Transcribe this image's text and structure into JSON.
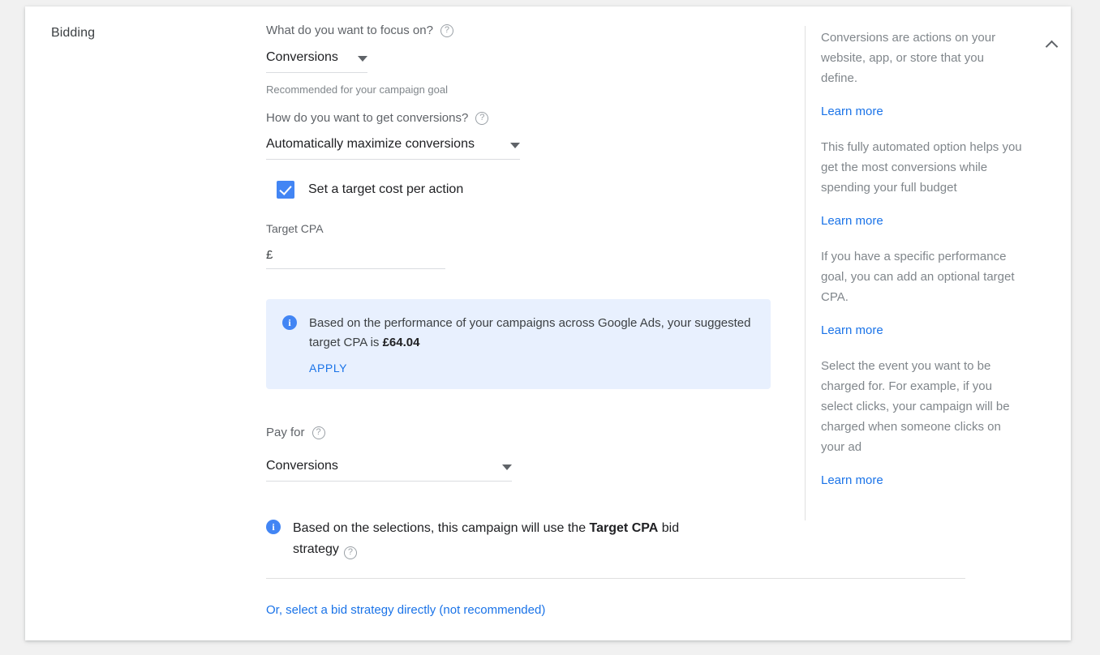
{
  "section": {
    "title": "Bidding"
  },
  "focus": {
    "label": "What do you want to focus on?",
    "help_icon": "help-circle-icon",
    "value": "Conversions",
    "helper_text": "Recommended for your campaign goal"
  },
  "strategy": {
    "label": "How do you want to get conversions?",
    "help_icon": "help-circle-icon",
    "value": "Automatically maximize conversions"
  },
  "target_cpa_checkbox": {
    "label": "Set a target cost per action",
    "checked": true,
    "accent_color": "#4285f4"
  },
  "target_cpa_input": {
    "label": "Target CPA",
    "currency_prefix": "£",
    "value": "",
    "placeholder": ""
  },
  "suggestion_banner": {
    "icon": "info-circle-icon",
    "text_before": "Based on the performance of your campaigns across Google Ads, your suggested target CPA is ",
    "amount": "£64.04",
    "apply_label": "APPLY",
    "background_color": "#e8f0fe",
    "link_color": "#1a73e8"
  },
  "pay_for": {
    "label": "Pay for",
    "help_icon": "help-circle-icon",
    "value": "Conversions"
  },
  "summary": {
    "icon": "info-circle-icon",
    "text_before": "Based on the selections, this campaign will use the ",
    "strategy_name": "Target CPA",
    "text_after": " bid strategy",
    "help_icon": "help-circle-icon"
  },
  "bid_strategy_link": {
    "label": "Or, select a bid strategy directly (not recommended)",
    "color": "#1a73e8"
  },
  "help_panel": {
    "collapse_icon": "chevron-up-icon",
    "blocks": [
      {
        "text": "Conversions are actions on your website, app, or store that you define.",
        "link": "Learn more"
      },
      {
        "text": "This fully automated option helps you get the most conversions while spending your full budget",
        "link": "Learn more"
      },
      {
        "text": "If you have a specific performance goal, you can add an optional target CPA.",
        "link": "Learn more"
      },
      {
        "text": "Select the event you want to be charged for. For example, if you select clicks, your campaign will be charged when someone clicks on your ad",
        "link": "Learn more"
      }
    ]
  }
}
